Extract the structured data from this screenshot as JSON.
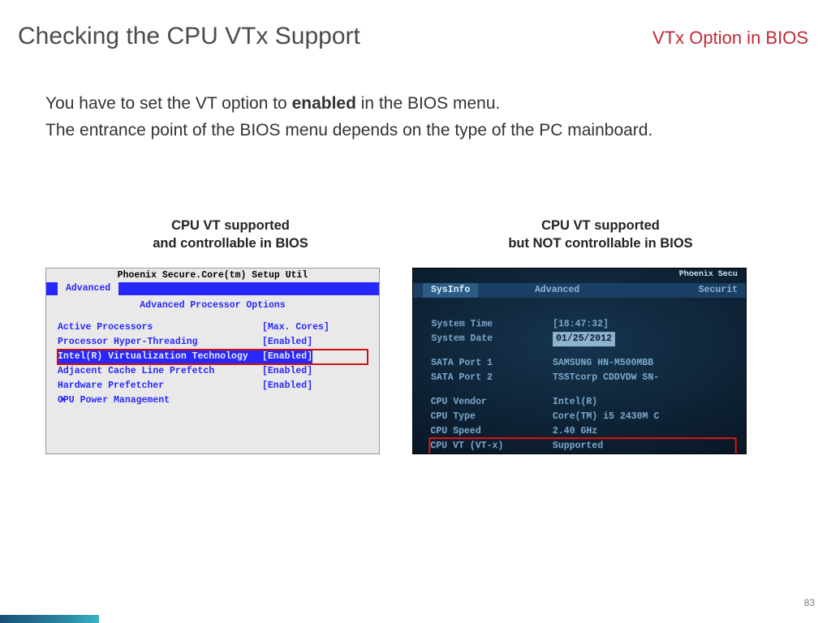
{
  "header": {
    "title": "Checking the CPU VTx Support",
    "subtitle": "VTx Option in BIOS"
  },
  "body": {
    "line1_pre": "You have to set the VT option to ",
    "line1_bold": "enabled",
    "line1_post": " in the BIOS menu.",
    "line2": "The entrance point of the BIOS menu depends on the type of the PC mainboard."
  },
  "captions": {
    "left_l1": "CPU VT supported",
    "left_l2": "and controllable in BIOS",
    "right_l1": "CPU VT supported",
    "right_l2": "but NOT controllable in BIOS"
  },
  "bios_left": {
    "title": "Phoenix Secure.Core(tm)  Setup Util",
    "tab": "Advanced",
    "section": "Advanced Processor Options",
    "rows": [
      {
        "label": "Active Processors",
        "value": "[Max. Cores]",
        "highlight": false,
        "red": false
      },
      {
        "label": "Processor Hyper-Threading",
        "value": "[Enabled]",
        "highlight": false,
        "red": false
      },
      {
        "label": "Intel(R) Virtualization Technology",
        "value": "[Enabled]",
        "highlight": true,
        "red": true
      },
      {
        "label": "Adjacent Cache Line Prefetch",
        "value": "[Enabled]",
        "highlight": false,
        "red": false
      },
      {
        "label": "Hardware Prefetcher",
        "value": "[Enabled]",
        "highlight": false,
        "red": false
      },
      {
        "label": "CPU Power Management",
        "value": "",
        "highlight": false,
        "red": false,
        "arrow": true
      }
    ]
  },
  "bios_right": {
    "title": "Phoenix Secu",
    "tabs": {
      "active": "SysInfo",
      "adv": "Advanced",
      "sec": "Securit"
    },
    "rows": [
      {
        "label": "System Time",
        "value": "[18:47:32]"
      },
      {
        "label": "System Date",
        "value": "01/25/2012",
        "hl_date": true
      }
    ],
    "rows2": [
      {
        "label": "SATA Port 1",
        "value": "SAMSUNG HN-M500MBB"
      },
      {
        "label": "SATA Port 2",
        "value": "TSSTcorp CDDVDW SN-"
      }
    ],
    "rows3": [
      {
        "label": "CPU Vendor",
        "value": "Intel(R)"
      },
      {
        "label": "CPU Type",
        "value": "Core(TM) i5 2430M C"
      },
      {
        "label": "CPU Speed",
        "value": "2.40 GHz"
      },
      {
        "label": "CPU VT (VT-x)",
        "value": "Supported",
        "red": true
      }
    ]
  },
  "footer": {
    "page": "83"
  }
}
